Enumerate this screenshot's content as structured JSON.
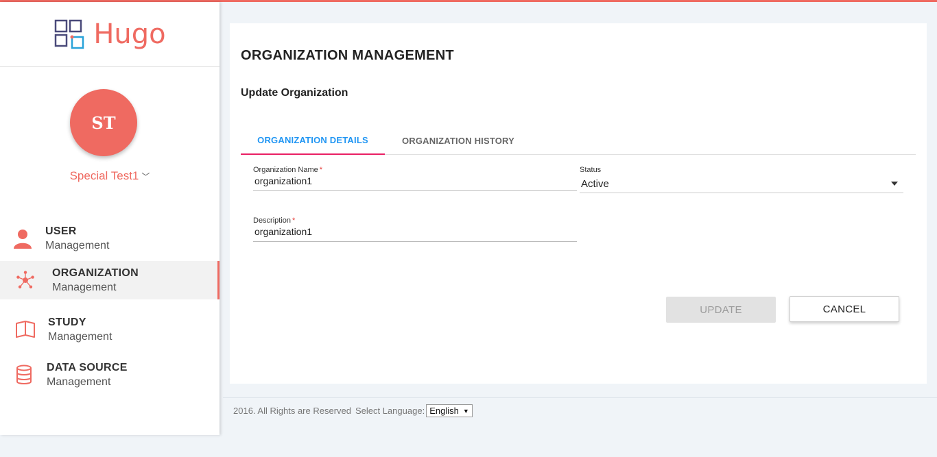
{
  "brand": {
    "name": "Hugo",
    "accent_color": "#ef6a61"
  },
  "user": {
    "initials": "ST",
    "name": "Special Test1"
  },
  "sidebar": {
    "items": [
      {
        "title": "USER",
        "subtitle": "Management",
        "icon": "user-icon"
      },
      {
        "title": "ORGANIZATION",
        "subtitle": "Management",
        "icon": "network-icon",
        "active": true
      },
      {
        "title": "STUDY",
        "subtitle": "Management",
        "icon": "book-icon"
      },
      {
        "title": "DATA SOURCE",
        "subtitle": "Management",
        "icon": "database-icon"
      }
    ]
  },
  "page": {
    "title": "ORGANIZATION MANAGEMENT",
    "subtitle": "Update Organization"
  },
  "tabs": [
    {
      "label": "ORGANIZATION DETAILS",
      "active": true
    },
    {
      "label": "ORGANIZATION HISTORY",
      "active": false
    }
  ],
  "form": {
    "name": {
      "label": "Organization Name",
      "required": "*",
      "value": "organization1"
    },
    "status": {
      "label": "Status",
      "value": "Active"
    },
    "description": {
      "label": "Description",
      "required": "*",
      "value": "organization1"
    }
  },
  "buttons": {
    "update": "UPDATE",
    "cancel": "CANCEL"
  },
  "footer": {
    "copyright": "2016. All Rights are Reserved",
    "language_label": "Select Language:",
    "language_value": "English"
  }
}
